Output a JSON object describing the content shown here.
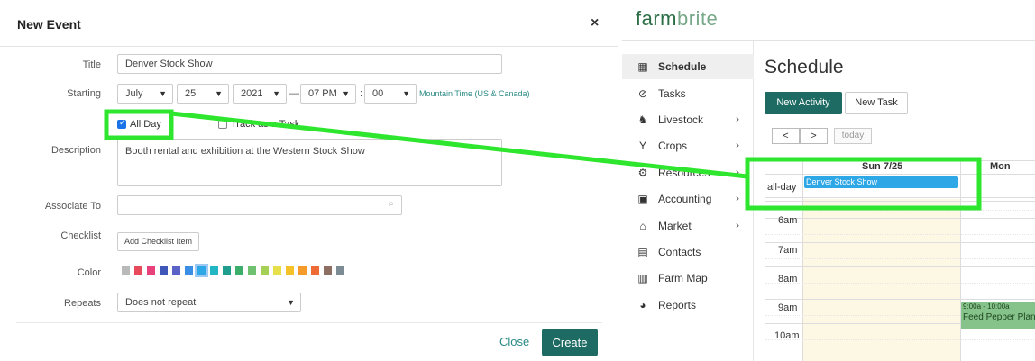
{
  "modal": {
    "title": "New Event",
    "close_glyph": "×",
    "fields": {
      "title_label": "Title",
      "title_value": "Denver Stock Show",
      "starting_label": "Starting",
      "month": "July",
      "day": "25",
      "year": "2021",
      "hour": "07 PM",
      "colon": ":",
      "minute": "00",
      "dash": "—",
      "timezone": "Mountain Time (US & Canada)",
      "all_day_label": "All Day",
      "all_day_checked": true,
      "track_label": "Track as a Task",
      "track_checked": false,
      "description_label": "Description",
      "description_value": "Booth rental and exhibition at the Western Stock Show",
      "associate_label": "Associate To",
      "associate_value": "",
      "checklist_label": "Checklist",
      "add_checklist": "Add Checklist Item",
      "color_label": "Color",
      "colors": [
        "#b9b9b9",
        "#e64a5b",
        "#e8407a",
        "#3e57b8",
        "#5c63c6",
        "#3a8ee6",
        "#2ea7e6",
        "#22b5c4",
        "#1f9e8e",
        "#3cae6b",
        "#6fc06f",
        "#a6cf55",
        "#e6df4a",
        "#f4c228",
        "#f59b2a",
        "#ef6b35",
        "#8d6e63",
        "#7d8b94"
      ],
      "selected_color_index": 6,
      "repeats_label": "Repeats",
      "repeats_value": "Does not repeat"
    },
    "footer": {
      "close": "Close",
      "create": "Create"
    }
  },
  "app": {
    "logo_main": "farm",
    "logo_accent": "brite",
    "brand_color": "#1d6b62",
    "sidebar": [
      {
        "label": "Schedule",
        "icon": "calendar-icon",
        "active": true,
        "has_arrow": false
      },
      {
        "label": "Tasks",
        "icon": "check-circle-icon",
        "active": false,
        "has_arrow": false
      },
      {
        "label": "Livestock",
        "icon": "horse-icon",
        "active": false,
        "has_arrow": true
      },
      {
        "label": "Crops",
        "icon": "seedling-icon",
        "active": false,
        "has_arrow": true
      },
      {
        "label": "Resources",
        "icon": "tractor-icon",
        "active": false,
        "has_arrow": true
      },
      {
        "label": "Accounting",
        "icon": "calculator-icon",
        "active": false,
        "has_arrow": true
      },
      {
        "label": "Market",
        "icon": "store-icon",
        "active": false,
        "has_arrow": true
      },
      {
        "label": "Contacts",
        "icon": "contact-card-icon",
        "active": false,
        "has_arrow": false
      },
      {
        "label": "Farm Map",
        "icon": "map-icon",
        "active": false,
        "has_arrow": false
      },
      {
        "label": "Reports",
        "icon": "pie-chart-icon",
        "active": false,
        "has_arrow": false
      }
    ],
    "page_title": "Schedule",
    "buttons": {
      "new_activity": "New Activity",
      "new_task": "New Task",
      "prev": "<",
      "next": ">",
      "today": "today"
    },
    "calendar": {
      "col_headers": [
        "Sun 7/25",
        "Mon"
      ],
      "all_day_label": "all-day",
      "all_day_event": "Denver Stock Show",
      "time_labels": [
        "6am",
        "7am",
        "8am",
        "9am",
        "10am"
      ],
      "timed_event": {
        "time": "9:00a - 10:00a",
        "title": "Feed Pepper Plants"
      }
    }
  },
  "annotation": {
    "color": "#2ee62e"
  }
}
